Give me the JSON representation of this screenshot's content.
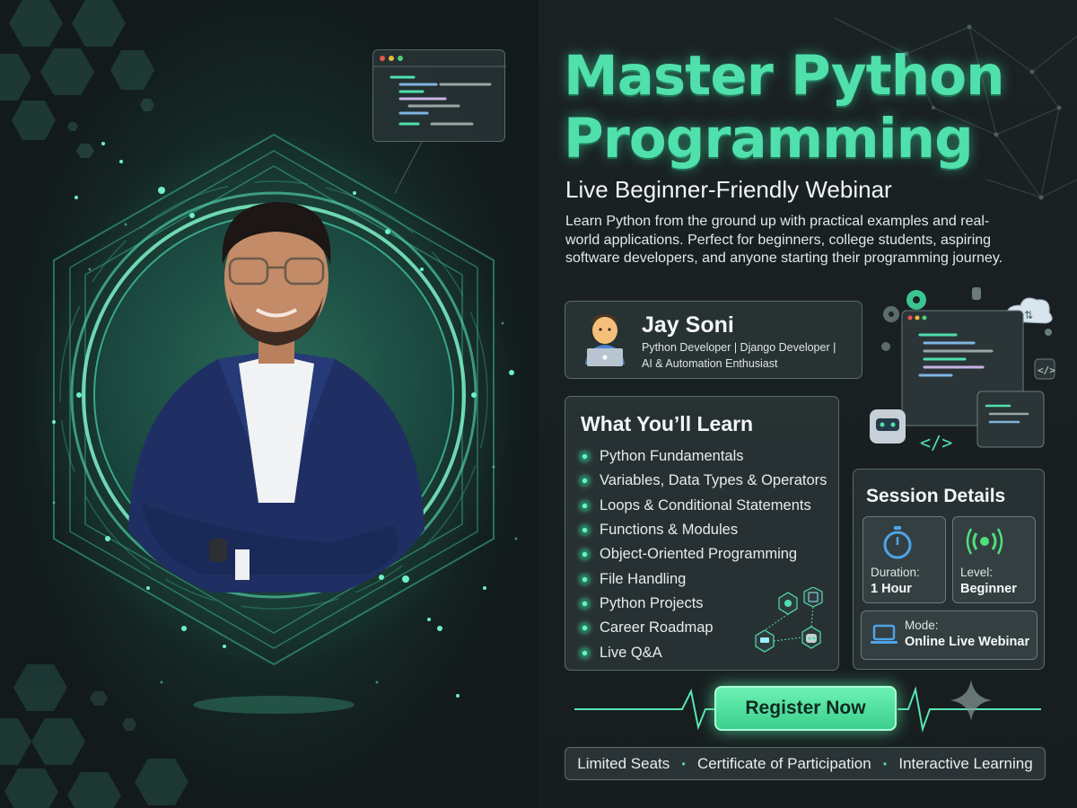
{
  "header": {
    "title_line1": "Master Python",
    "title_line2": "Programming",
    "subtitle": "Live Beginner-Friendly Webinar",
    "description": "Learn Python from the ground up with practical examples and real-world applications. Perfect for beginners, college students, aspiring software developers, and anyone starting their programming journey."
  },
  "speaker": {
    "avatar_icon": "developer-laptop-emoji",
    "name": "Jay Soni",
    "role_line1": "Python Developer | Django Developer |",
    "role_line2": "AI & Automation Enthusiast"
  },
  "learn": {
    "title": "What You’ll Learn",
    "items": [
      "Python Fundamentals",
      "Variables, Data Types & Operators",
      "Loops & Conditional Statements",
      "Functions & Modules",
      "Object-Oriented Programming",
      "File Handling",
      "Python Projects",
      "Career Roadmap",
      "Live Q&A"
    ]
  },
  "session": {
    "title": "Session Details",
    "duration_label": "Duration:",
    "duration_value": "1 Hour",
    "level_label": "Level:",
    "level_value": "Beginner",
    "mode_label": "Mode:",
    "mode_value": "Online Live Webinar"
  },
  "cta": {
    "register_label": "Register Now"
  },
  "footer": {
    "items": [
      "Limited Seats",
      "Certificate of Participation",
      "Interactive Learning"
    ],
    "separator": "•"
  },
  "colors": {
    "accent": "#4fe0ac",
    "background": "#141b1c",
    "panel": "#2c3739"
  }
}
